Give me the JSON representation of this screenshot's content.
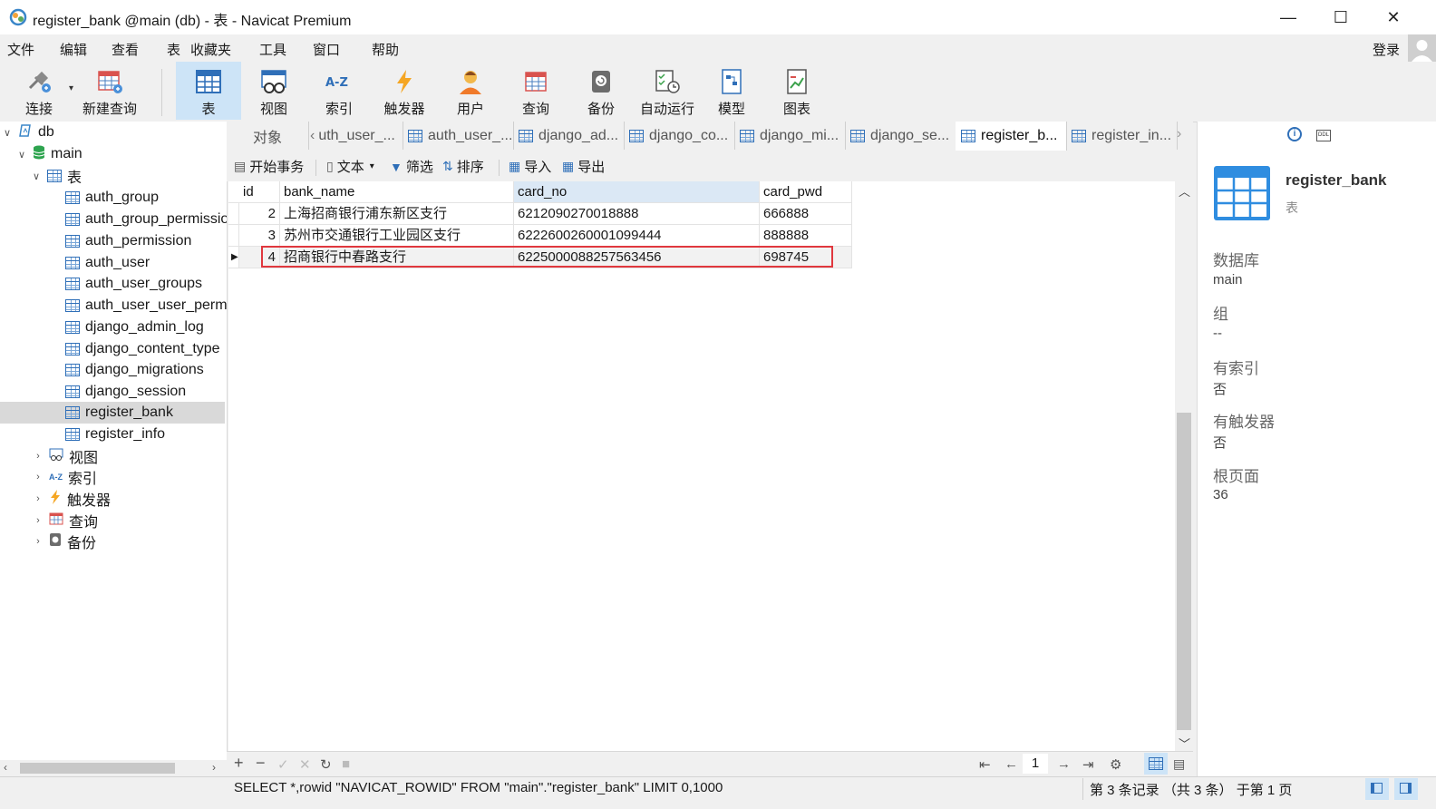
{
  "window": {
    "title": "register_bank @main (db) - 表 - Navicat Premium",
    "min": "—",
    "max": "☐",
    "close": "✕"
  },
  "menu": [
    "文件",
    "编辑",
    "查看",
    "表",
    "收藏夹",
    "工具",
    "窗口",
    "帮助"
  ],
  "login": "登录",
  "toolbar": [
    "连接",
    "新建查询",
    "表",
    "视图",
    "索引",
    "触发器",
    "用户",
    "查询",
    "备份",
    "自动运行",
    "模型",
    "图表"
  ],
  "tree": {
    "db": "db",
    "schema": "main",
    "tables_group": "表",
    "tables": [
      "auth_group",
      "auth_group_permissio",
      "auth_permission",
      "auth_user",
      "auth_user_groups",
      "auth_user_user_permi",
      "django_admin_log",
      "django_content_type",
      "django_migrations",
      "django_session",
      "register_bank",
      "register_info"
    ],
    "groups": [
      "视图",
      "索引",
      "触发器",
      "查询",
      "备份"
    ]
  },
  "tabs": [
    "对象",
    "uth_user_...",
    "auth_user_...",
    "django_ad...",
    "django_co...",
    "django_mi...",
    "django_se...",
    "register_b...",
    "register_in..."
  ],
  "ctoolbar": [
    "开始事务",
    "文本",
    "筛选",
    "排序",
    "导入",
    "导出"
  ],
  "grid": {
    "columns": [
      "id",
      "bank_name",
      "card_no",
      "card_pwd"
    ],
    "rows": [
      [
        "2",
        "上海招商银行浦东新区支行",
        "6212090270018888",
        "666888"
      ],
      [
        "3",
        "苏州市交通银行工业园区支行",
        "6222600260001099444",
        "888888"
      ],
      [
        "4",
        "招商银行中春路支行",
        "6225000088257563456",
        "698745"
      ]
    ]
  },
  "nav": {
    "page": "1"
  },
  "status": {
    "sql": "SELECT *,rowid \"NAVICAT_ROWID\" FROM \"main\".\"register_bank\" LIMIT 0,1000",
    "records": "第 3 条记录 （共 3 条） 于第 1 页"
  },
  "panel": {
    "name": "register_bank",
    "type": "表",
    "db_label": "数据库",
    "db_val": "main",
    "group_label": "组",
    "group_val": "--",
    "index_label": "有索引",
    "index_val": "否",
    "trigger_label": "有触发器",
    "trigger_val": "否",
    "root_label": "根页面",
    "root_val": "36"
  },
  "colors": {
    "accent": "#2f6fb8",
    "selected_tab_bg": "#cde4f7",
    "highlight_box": "#e0383e"
  }
}
